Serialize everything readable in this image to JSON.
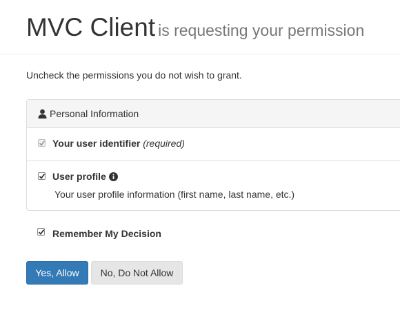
{
  "header": {
    "client_name": "MVC Client",
    "subtitle": "is requesting your permission"
  },
  "intro": "Uncheck the permissions you do not wish to grant.",
  "panel": {
    "heading": "Personal Information",
    "heading_icon": "user-icon",
    "scopes": [
      {
        "label": "Your user identifier",
        "required_note": "(required)",
        "checked": true,
        "disabled": true
      },
      {
        "label": "User profile",
        "info_icon": "info-circle-icon",
        "description": "Your user profile information (first name, last name, etc.)",
        "checked": true,
        "disabled": false
      }
    ]
  },
  "remember": {
    "label": "Remember My Decision",
    "checked": true
  },
  "buttons": {
    "allow": "Yes, Allow",
    "deny": "No, Do Not Allow"
  },
  "colors": {
    "primary": "#337ab7",
    "secondary": "#e6e6e6",
    "muted": "#777777"
  }
}
